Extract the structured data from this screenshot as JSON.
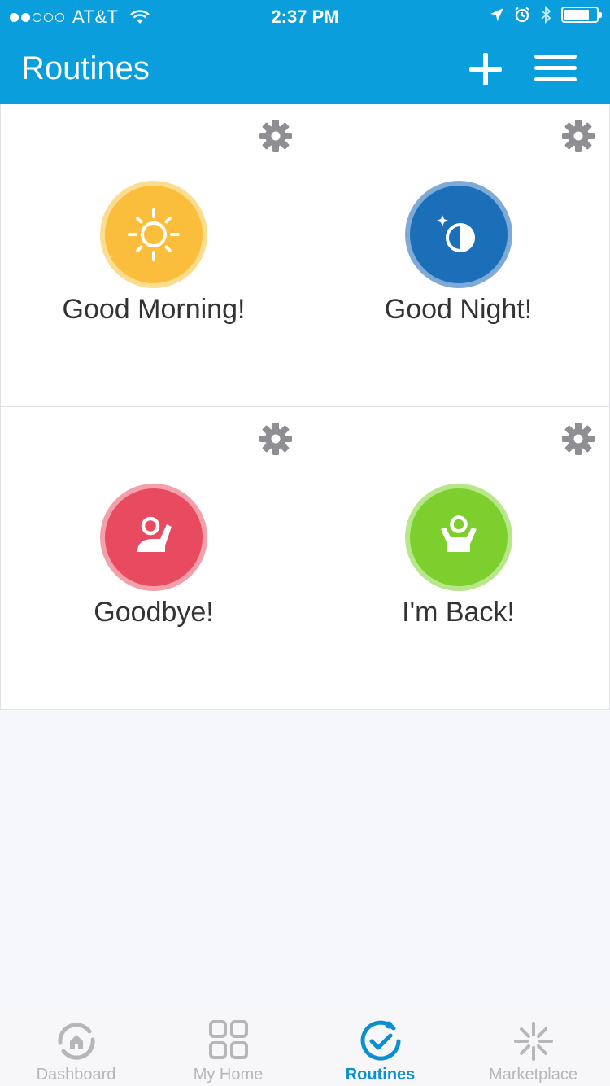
{
  "status_bar": {
    "carrier": "AT&T",
    "time": "2:37 PM",
    "signal_bars_filled": 2,
    "signal_bars_total": 5,
    "battery_level": 0.8
  },
  "header": {
    "title": "Routines",
    "add_icon": "plus-icon",
    "menu_icon": "hamburger-menu-icon"
  },
  "routines": [
    {
      "label": "Good Morning!",
      "icon": "sun-icon",
      "color": "#fbbe3c",
      "ring": "#fcdc8f"
    },
    {
      "label": "Good Night!",
      "icon": "moon-icon",
      "color": "#1b6fb8",
      "ring": "#7fa9d6"
    },
    {
      "label": "Goodbye!",
      "icon": "person-waving-icon",
      "color": "#e84a5f",
      "ring": "#f4a0aa"
    },
    {
      "label": "I'm Back!",
      "icon": "person-arms-up-icon",
      "color": "#7ccf2d",
      "ring": "#b8e68a"
    }
  ],
  "tabs": [
    {
      "label": "Dashboard",
      "icon": "dashboard-home-icon",
      "active": false
    },
    {
      "label": "My Home",
      "icon": "grid-icon",
      "active": false
    },
    {
      "label": "Routines",
      "icon": "check-circle-icon",
      "active": true
    },
    {
      "label": "Marketplace",
      "icon": "sparkle-icon",
      "active": false
    }
  ],
  "colors": {
    "accent": "#0a9edc",
    "active_tab": "#0a8fd1",
    "inactive_tab": "#b6b6ba"
  }
}
